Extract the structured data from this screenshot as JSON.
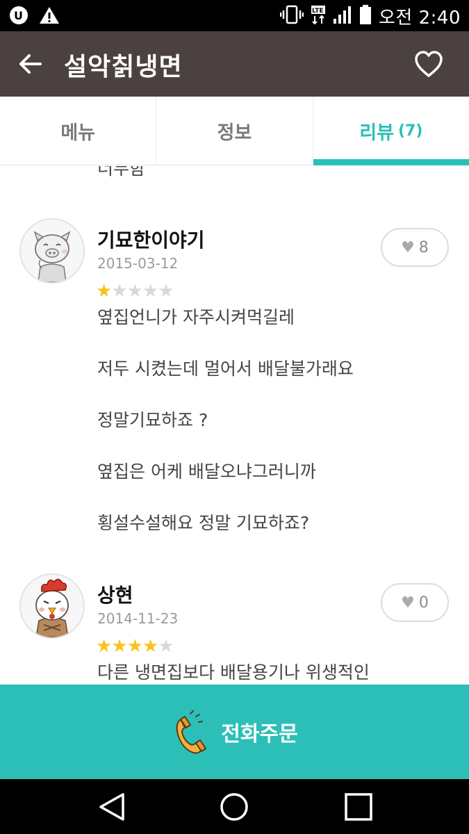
{
  "status_bar": {
    "time": "오전 2:40",
    "lte_label": "LTE",
    "icons": [
      "u-plus-logo-icon",
      "warning-icon",
      "vibrate-icon",
      "lte-icon",
      "signal-icon",
      "battery-icon"
    ]
  },
  "app_bar": {
    "title": "설악칡냉면",
    "back_icon": "arrow-left-icon",
    "favorite_icon": "heart-outline-icon"
  },
  "tabs": [
    {
      "label": "메뉴",
      "active": false
    },
    {
      "label": "정보",
      "active": false
    },
    {
      "label": "리뷰",
      "count": "(7)",
      "active": true
    }
  ],
  "content": {
    "cutoff_text": "너무함",
    "reviews": [
      {
        "name": "기묘한이야기",
        "date": "2015-03-12",
        "rating": 1,
        "likes": "8",
        "avatar_icon": "pig-avatar-icon",
        "lines": [
          "옆집언니가 자주시켜먹길레",
          "저두 시켰는데 멀어서 배달불가래요",
          "정말기묘하죠 ?",
          "옆집은 어케 배달오냐그러니까",
          "횡설수설해요 정말 기묘하죠?"
        ]
      },
      {
        "name": "상현",
        "date": "2014-11-23",
        "rating": 4,
        "likes": "0",
        "avatar_icon": "chicken-avatar-icon",
        "lines": [
          "다른 냉면집보다 배달용기나 위생적인"
        ]
      }
    ]
  },
  "order_button": {
    "label": "전화주문",
    "icon": "phone-handset-icon"
  },
  "nav_bar": {
    "icons": [
      "back-triangle-icon",
      "home-circle-icon",
      "recents-square-icon"
    ]
  },
  "colors": {
    "app_bar": "#4a4140",
    "accent": "#2bbfb8",
    "star_on": "#f7c31c",
    "star_off": "#d8d8d8"
  }
}
